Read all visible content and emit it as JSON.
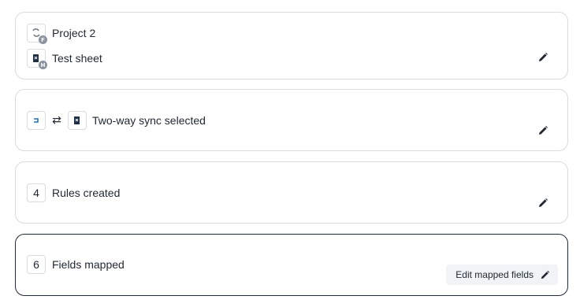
{
  "cards": {
    "project": {
      "source_name": "Project 2",
      "source_badge": "F",
      "target_name": "Test sheet",
      "target_badge": "H",
      "edit_icon": "pencil-icon"
    },
    "sync": {
      "label": "Two-way sync selected",
      "direction_glyph": "⇄",
      "left_icon": "app-logo-icon",
      "right_icon": "sheet-logo-icon",
      "edit_icon": "pencil-icon"
    },
    "rules": {
      "count": "4",
      "label": "Rules created",
      "edit_icon": "pencil-icon"
    },
    "fields": {
      "count": "6",
      "label": "Fields mapped",
      "button_label": "Edit mapped fields",
      "edit_icon": "pencil-icon"
    }
  },
  "colors": {
    "border": "#d7dbe2",
    "active_border": "#1c2a3a",
    "text": "#1f2733",
    "accent_blue": "#1a73c8",
    "button_bg": "#f1f3f6"
  }
}
